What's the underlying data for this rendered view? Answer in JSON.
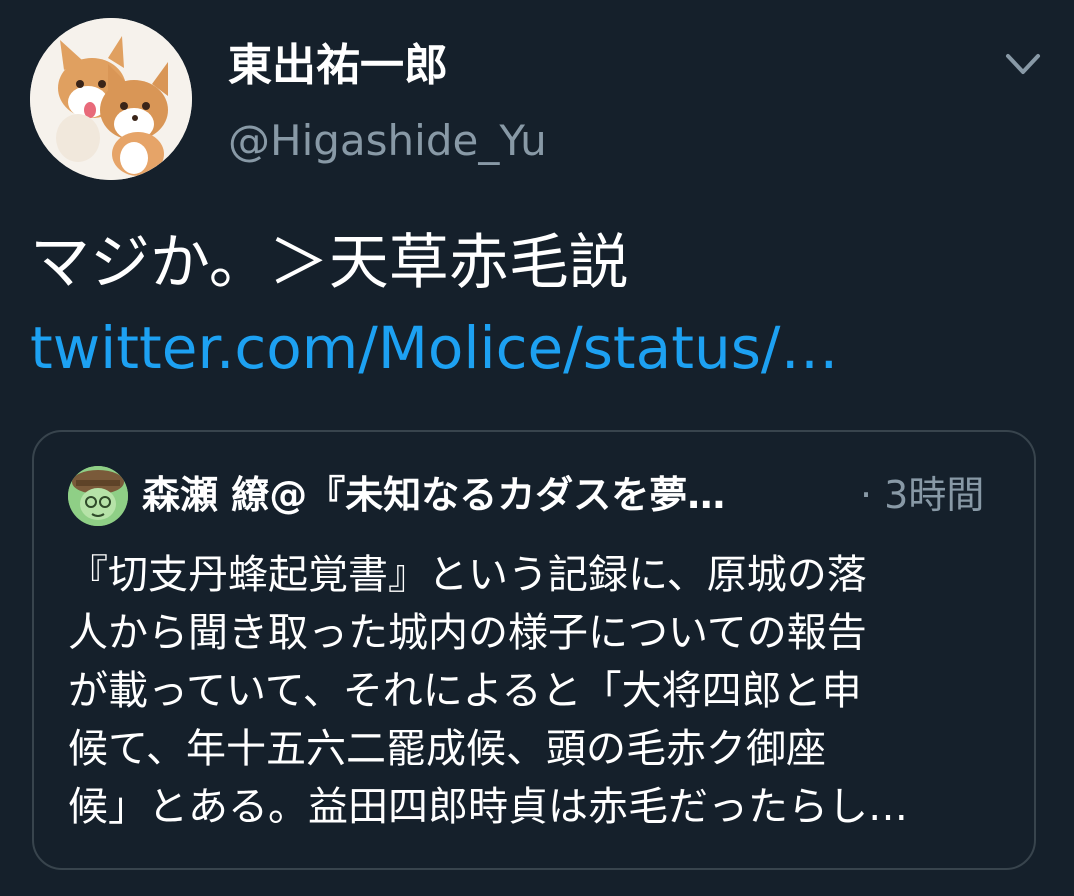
{
  "author": {
    "display_name": "東出祐一郎",
    "handle": "@Higashide_Yu",
    "avatar_icon": "corgi-dogs-avatar"
  },
  "menu_icon": "chevron-down-icon",
  "tweet": {
    "text": "マジか。＞天草赤毛説",
    "link_text": "twitter.com/Molice/status/…"
  },
  "quoted_tweet": {
    "author_name": "森瀬 繚@『未知なるカダスを夢…",
    "time": "· 3時間",
    "avatar_icon": "green-character-avatar",
    "lines": [
      "『切支丹蜂起覚書』という記録に、原城の落",
      "人から聞き取った城内の様子についての報告",
      "が載っていて、それによると「大将四郎と申",
      "候て、年十五六二罷成候、頭の毛赤ク御座",
      "候」とある。益田四郎時貞は赤毛だったらし…"
    ]
  },
  "colors": {
    "background": "#15202b",
    "link": "#1da1f2",
    "secondary_text": "#8899a6",
    "border": "#38444d"
  }
}
